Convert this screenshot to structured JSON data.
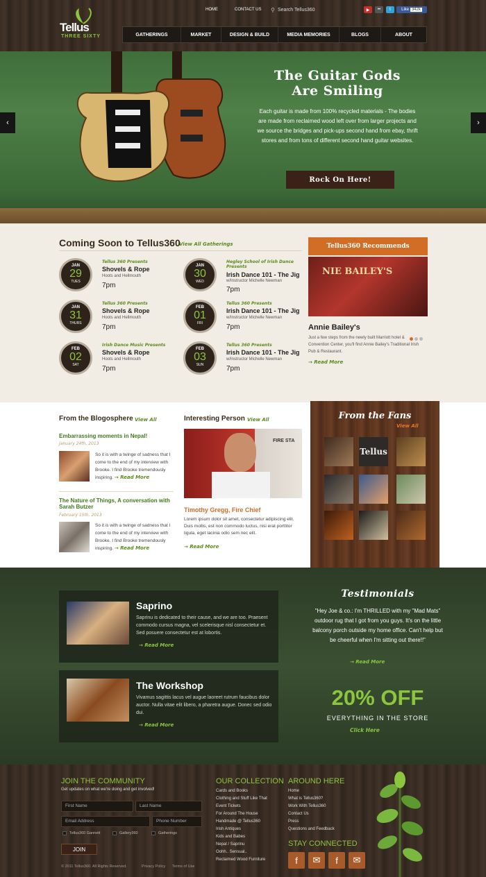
{
  "header": {
    "logo_main": "Tellus",
    "logo_sub": "THREE SIXTY",
    "top_links": [
      "HOME",
      "CONTACT US"
    ],
    "search_placeholder": "Search Tellus360",
    "like_label": "Like",
    "like_count": "342k",
    "nav": [
      "GATHERINGS",
      "MARKET",
      "DESIGN & BUILD",
      "MEDIA MEMORIES",
      "BLOGS",
      "ABOUT"
    ]
  },
  "hero": {
    "title_line1": "The Guitar Gods",
    "title_line2": "Are Smiling",
    "text": "Each guitar is made from 100% recycled materials - The bodies are made from reclaimed wood left over from larger projects and we source the bridges and pick-ups second hand from ebay, thrift stores and from tons of different second hand guitar websites.",
    "cta": "Rock On Here!",
    "prev": "‹",
    "next": "›"
  },
  "coming": {
    "title": "Coming Soon to Tellus360",
    "view_all": "View All Gatherings",
    "events": [
      {
        "month": "JAN",
        "day": "29",
        "weekday": "TUES",
        "presenter": "Tellus 360 Presents",
        "title": "Shovels & Rope",
        "sub": "Hoots and Hellmouth",
        "time": "7pm"
      },
      {
        "month": "JAN",
        "day": "31",
        "weekday": "THURS",
        "presenter": "Tellus 360 Presents",
        "title": "Shovels & Rope",
        "sub": "Hoots and Hellmouth",
        "time": "7pm"
      },
      {
        "month": "FEB",
        "day": "02",
        "weekday": "SAT",
        "presenter": "Irish Dance Music Presents",
        "title": "Shovels & Rope",
        "sub": "Hoots and Hellmouth",
        "time": "7pm"
      },
      {
        "month": "JAN",
        "day": "30",
        "weekday": "WED",
        "presenter": "Hegley School of Irish Dance Presents",
        "title": "Irish Dance 101 - The Jig",
        "sub": "w/Instructor Michelle Newman",
        "time": "7pm"
      },
      {
        "month": "FEB",
        "day": "01",
        "weekday": "FRI",
        "presenter": "Tellus 360 Presents",
        "title": "Irish Dance 101 - The Jig",
        "sub": "w/Instructor Michelle Newman",
        "time": "7pm"
      },
      {
        "month": "FEB",
        "day": "03",
        "weekday": "SUN",
        "presenter": "Tellus 360 Presents",
        "title": "Irish Dance 101 - The Jig",
        "sub": "w/Instructor Michelle Newman",
        "time": "7pm"
      }
    ]
  },
  "recommend": {
    "heading": "Tellus360 Recommends",
    "photo_sign": "NIE BAILEY'S",
    "title": "Annie Bailey's",
    "text": "Just a few steps from the newly built Marriott hotel & Convention Center, you'll find Annie Bailey's Traditional Irish Pub & Restaurant.",
    "read_more": "→ Read More"
  },
  "blogs": {
    "title": "From the Blogosphere",
    "view_all": "View All",
    "posts": [
      {
        "title": "Embarrassing moments in Nepal!",
        "date": "January 24th, 2013",
        "text": "So it is with a twinge of sadness that I come to the end of my interview with Brooke.  I find Brooke tremendously inspiring.",
        "read_more": "→ Read More"
      },
      {
        "title": "The Nature of Things, A conversation with Sarah Butzer",
        "date": "February 15th, 2013",
        "text": "So it is with a twinge of sadness that I come to the end of my interview with Brooke.  I find Brooke tremendously inspiring.",
        "read_more": "→ Read More"
      }
    ]
  },
  "person": {
    "title": "Interesting Person",
    "view_all": "View All",
    "photo_sign": "FIRE STA",
    "name": "Timothy Gregg, Fire Chief",
    "text": "Lorem ipsum dolor sit amet, consectetur adipiscing elit. Duis mollis, est non commodo luctus, nisi erat porttitor ligula, eget lacinia odio sem nec elit.",
    "read_more": "→ Read More"
  },
  "fans": {
    "title": "From the Fans",
    "view_all": "View All",
    "sign_text": "Tellus"
  },
  "causes": [
    {
      "title": "Saprino",
      "text": "Saprinu is dedicated to their cause, and we are too. Praesent commodo cursus magna, vel scelerisque nisl consectetur et. Sed posuere consectetur est at lobortis.",
      "read_more": "→ Read More"
    },
    {
      "title": "The Workshop",
      "text": "Vivamus sagittis lacus vel augue laoreet rutrum faucibus dolor auctor. Nulla vitae elit libero, a pharetra augue. Donec sed odio dui.",
      "read_more": "→ Read More"
    }
  ],
  "testimonials": {
    "title": "Testimonials",
    "quote": "\"Hey Joe & co.: I'm THRILLED with my \"Mad Mats\" outdoor rug that I got from you guys. It's on the little balcony porch outside my home office. Can't help but be cheerful when I'm sitting out there!!\"",
    "read_more": "→ Read More"
  },
  "promo": {
    "big": "20% OFF",
    "sub": "EVERYTHING IN THE STORE",
    "link": "Click Here"
  },
  "footer": {
    "community_title": "Join The Community",
    "community_text": "Get updates on what we're doing and get involved!",
    "first_name": "First Name",
    "last_name": "Last Name",
    "email": "Email Address",
    "phone": "Phone Number",
    "checks": [
      "Tellus360 Gannett",
      "Gallery360",
      "Gatherings"
    ],
    "join": "JOIN",
    "collection_title": "Our Collection",
    "collection": [
      "Cards and Books",
      "Clothing and Stuff Like That",
      "Event Tickets",
      "For Around The House",
      "Handmade @ Tellus360",
      "Irish Antiques",
      "Kids and Babes",
      "Nepal / Saprinu",
      "Oohh.. Sensual..",
      "Reclaimed Wood Furniture"
    ],
    "around_title": "Around Here",
    "around": [
      "Home",
      "What is Tellus360?",
      "Work With Tellus360",
      "Contact Us",
      "Press",
      "Questions and Feedback"
    ],
    "stay_title": "Stay Connected",
    "copyright": "© 2011 Tellus360.  All Rights Reserved.",
    "privacy": "Privacy Policy",
    "terms": "Terms of Use"
  }
}
